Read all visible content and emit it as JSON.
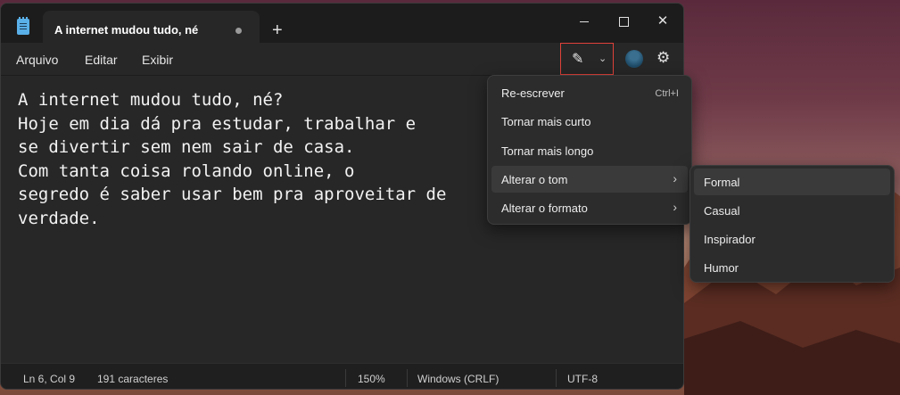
{
  "window": {
    "tab_title": "A internet mudou tudo, né",
    "new_tab_glyph": "+",
    "close_glyph": "✕"
  },
  "menubar": {
    "items": [
      "Arquivo",
      "Editar",
      "Exibir"
    ],
    "chevron_glyph": "⌄",
    "cowriter_glyph": "✎",
    "gear_glyph": "⚙"
  },
  "editor": {
    "text": "A internet mudou tudo, né?\nHoje em dia dá pra estudar, trabalhar e\nse divertir sem nem sair de casa.\nCom tanta coisa rolando online, o\nsegredo é saber usar bem pra aproveitar de\nverdade."
  },
  "statusbar": {
    "position": "Ln 6, Col 9",
    "chars": "191 caracteres",
    "zoom": "150%",
    "line_ending": "Windows (CRLF)",
    "encoding": "UTF-8"
  },
  "rewrite_menu": {
    "items": [
      {
        "label": "Re-escrever",
        "shortcut": "Ctrl+I"
      },
      {
        "label": "Tornar mais curto"
      },
      {
        "label": "Tornar mais longo"
      },
      {
        "label": "Alterar o tom",
        "arrow": "›"
      },
      {
        "label": "Alterar o formato",
        "arrow": "›"
      }
    ]
  },
  "tone_submenu": {
    "items": [
      "Formal",
      "Casual",
      "Inspirador",
      "Humor"
    ]
  },
  "colors": {
    "accent_border": "#e0423a",
    "window_bg": "#272727",
    "menu_bg": "#2c2c2c"
  }
}
